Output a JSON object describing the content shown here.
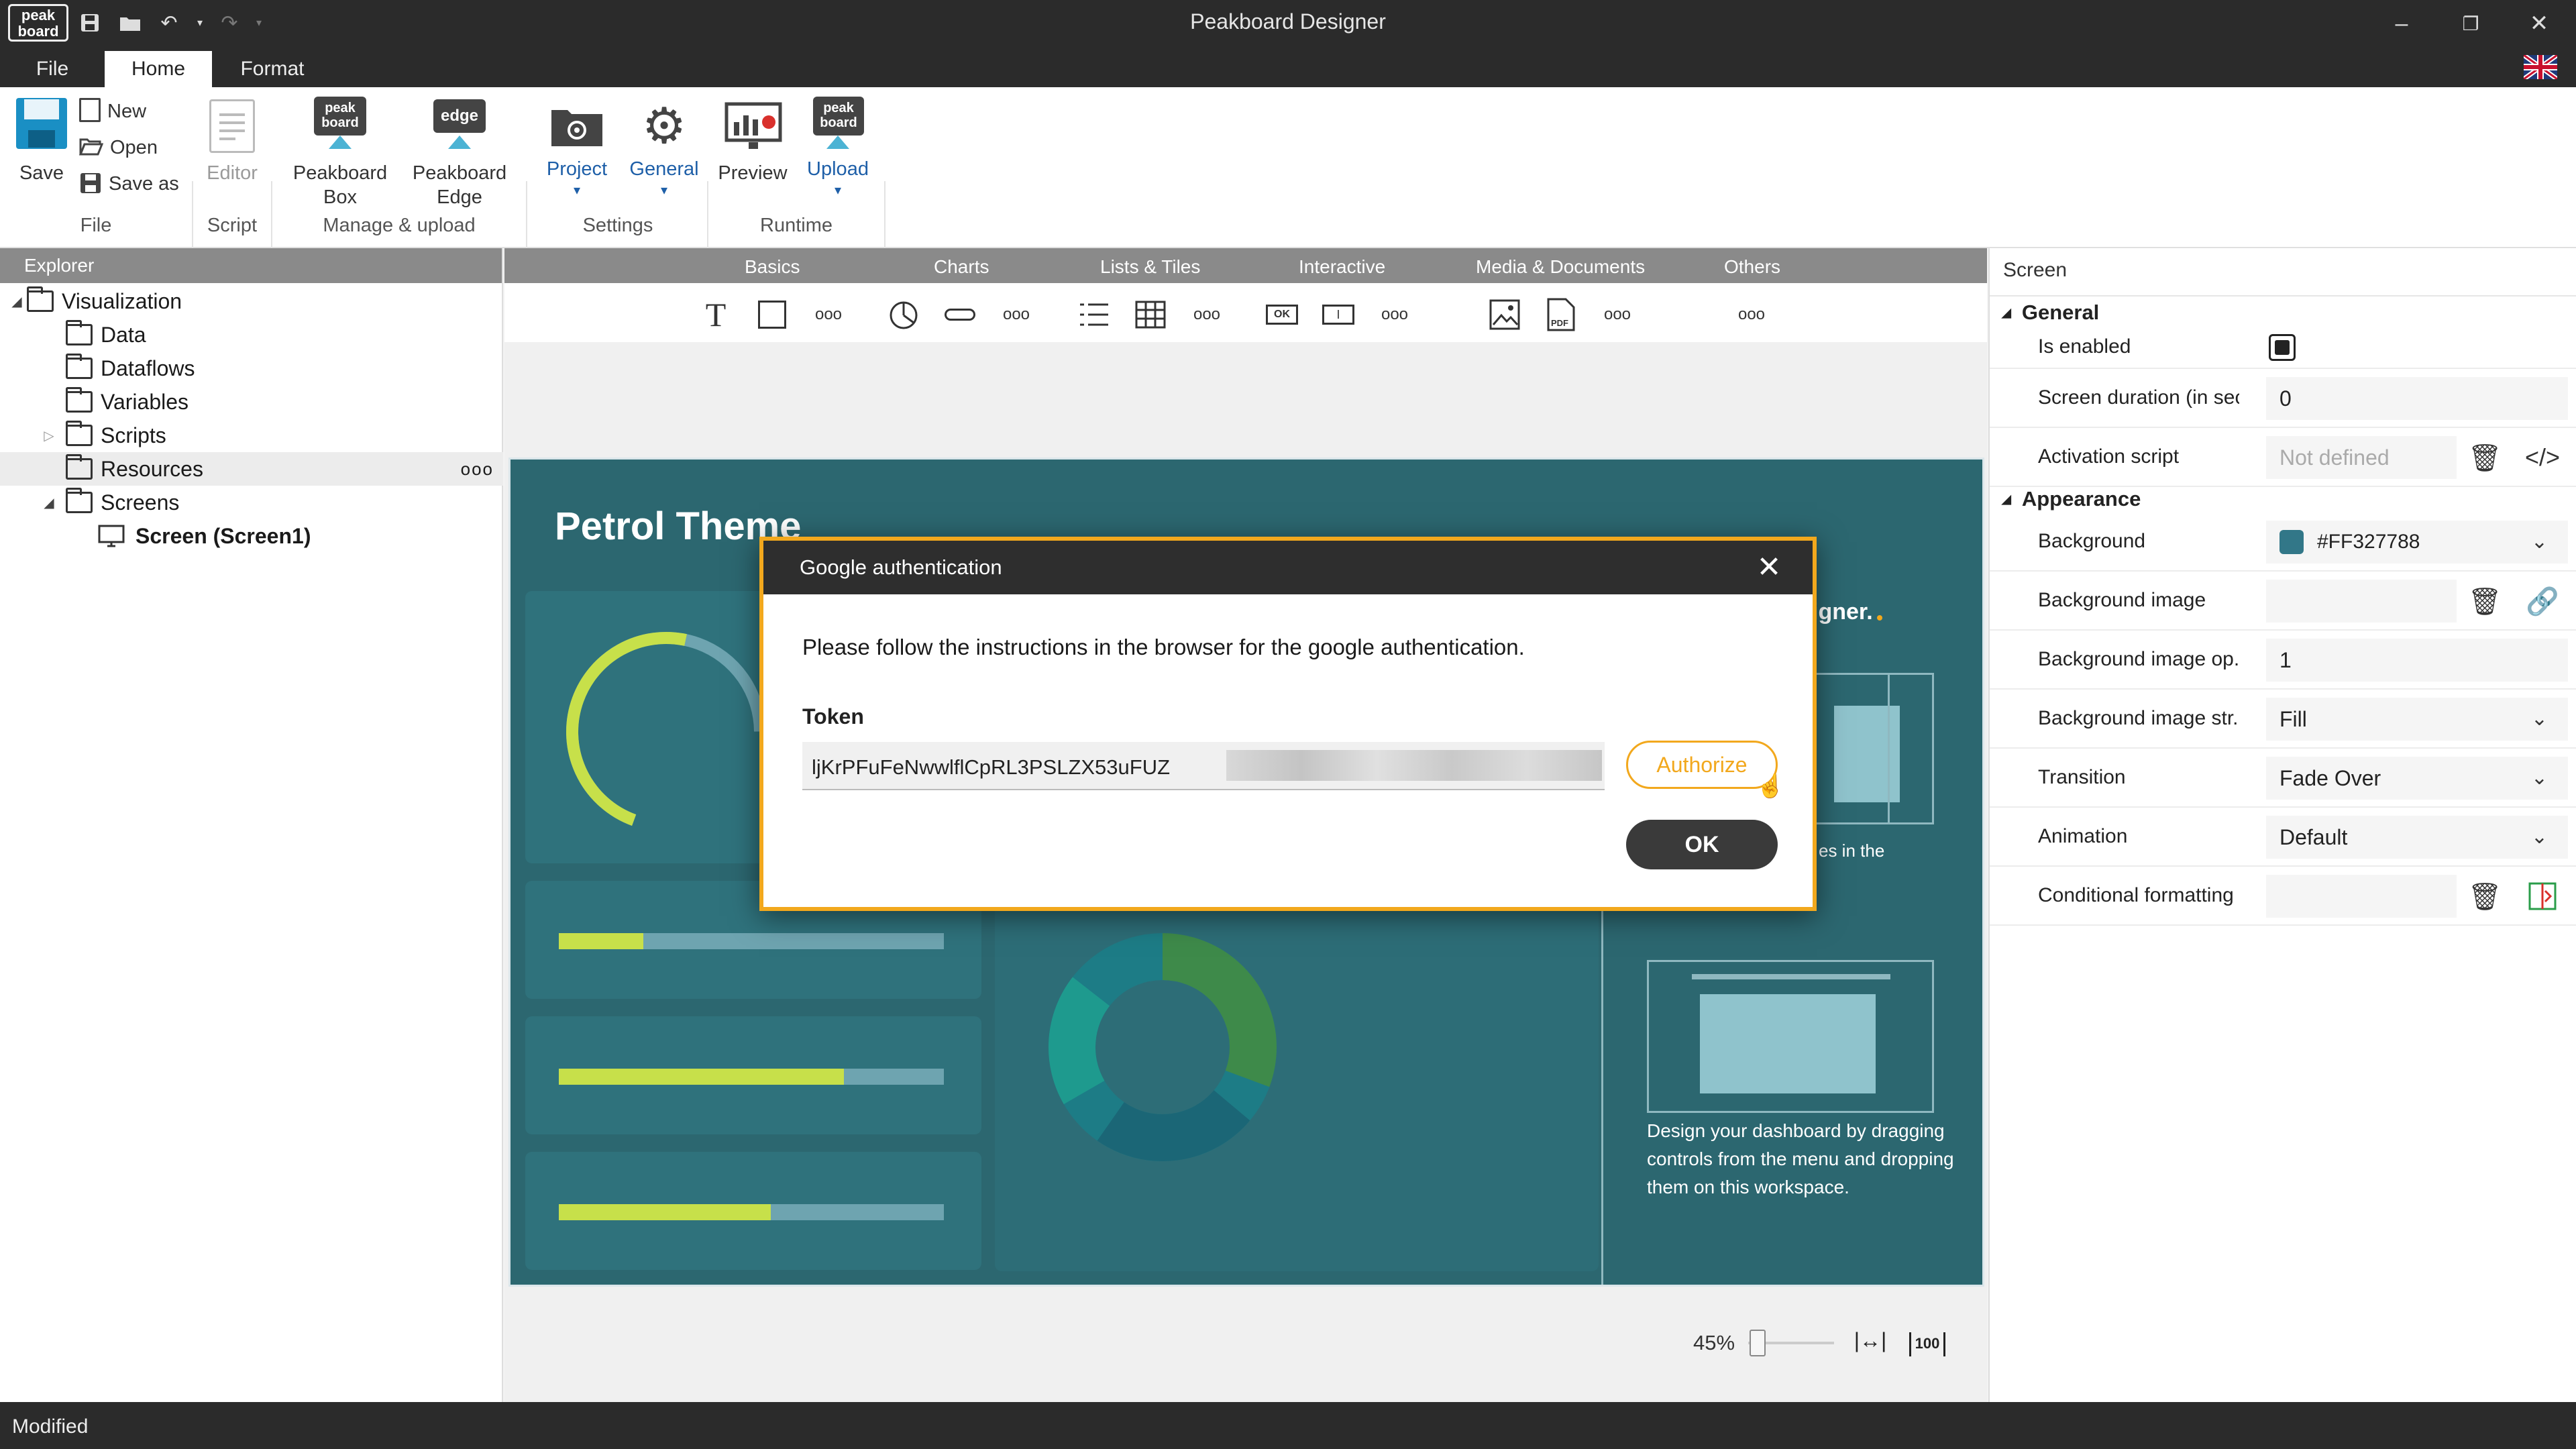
{
  "app": {
    "title": "Peakboard Designer",
    "logo_text": "peak board"
  },
  "menu": {
    "tabs": [
      {
        "label": "File"
      },
      {
        "label": "Home"
      },
      {
        "label": "Format"
      }
    ]
  },
  "ribbon": {
    "file_group": {
      "save": "Save",
      "new": "New",
      "open": "Open",
      "save_as": "Save as",
      "label": "File"
    },
    "script_group": {
      "editor": "Editor",
      "label": "Script"
    },
    "manage_group": {
      "box_line1": "Peakboard",
      "box_line2": "Box",
      "edge_line1": "Peakboard",
      "edge_line2": "Edge",
      "label": "Manage & upload",
      "box_icon_text": "peak board",
      "edge_icon_text": "edge"
    },
    "settings_group": {
      "project": "Project",
      "general": "General",
      "label": "Settings"
    },
    "runtime_group": {
      "preview": "Preview",
      "upload": "Upload",
      "label": "Runtime",
      "upload_icon_text": "peak board"
    }
  },
  "explorer": {
    "title": "Explorer",
    "items": [
      {
        "label": "Visualization"
      },
      {
        "label": "Data"
      },
      {
        "label": "Dataflows"
      },
      {
        "label": "Variables"
      },
      {
        "label": "Scripts"
      },
      {
        "label": "Resources"
      },
      {
        "label": "Screens"
      },
      {
        "label": "Screen (Screen1)"
      }
    ]
  },
  "toolbox": {
    "categories": [
      {
        "label": "Basics"
      },
      {
        "label": "Charts"
      },
      {
        "label": "Lists & Tiles"
      },
      {
        "label": "Interactive"
      },
      {
        "label": "Media & Documents"
      },
      {
        "label": "Others"
      }
    ]
  },
  "dashboard": {
    "title": "Petrol Theme",
    "partial_text_1": "e",
    "partial_text_2": "igner.",
    "partial_text_3": "es in the",
    "design_text": "Design your dashboard by dragging controls from the menu and dropping them on this workspace.",
    "bars": [
      0.22,
      0.74,
      0.55
    ]
  },
  "properties": {
    "title": "Screen",
    "sections": {
      "general": "General",
      "appearance": "Appearance"
    },
    "rows": {
      "is_enabled": {
        "label": "Is enabled"
      },
      "screen_duration": {
        "label": "Screen duration (in sec...",
        "value": "0"
      },
      "activation_script": {
        "label": "Activation script",
        "placeholder": "Not defined"
      },
      "background": {
        "label": "Background",
        "value": "#FF327788",
        "swatch": "#327788"
      },
      "background_image": {
        "label": "Background image"
      },
      "background_image_opacity": {
        "label": "Background image op...",
        "value": "1"
      },
      "background_image_stretch": {
        "label": "Background image str...",
        "value": "Fill"
      },
      "transition": {
        "label": "Transition",
        "value": "Fade Over"
      },
      "animation": {
        "label": "Animation",
        "value": "Default"
      },
      "conditional_formatting": {
        "label": "Conditional formatting"
      }
    }
  },
  "zoom": {
    "level": "45%",
    "level_value": 0.45,
    "fit_100": "100"
  },
  "status": {
    "text": "Modified"
  },
  "dialog": {
    "title": "Google authentication",
    "message": "Please follow the instructions in the browser for the google authentication.",
    "token_label": "Token",
    "token_value": "ljKrPFuFeNwwlflCpRL3PSLZX53uFUZ",
    "authorize": "Authorize",
    "ok": "OK"
  },
  "colors": {
    "accent": "#f2a81d",
    "dashboard_bg": "#2c6770",
    "ribbon_blue": "#1e5fa8",
    "lime": "#c7e04a"
  }
}
